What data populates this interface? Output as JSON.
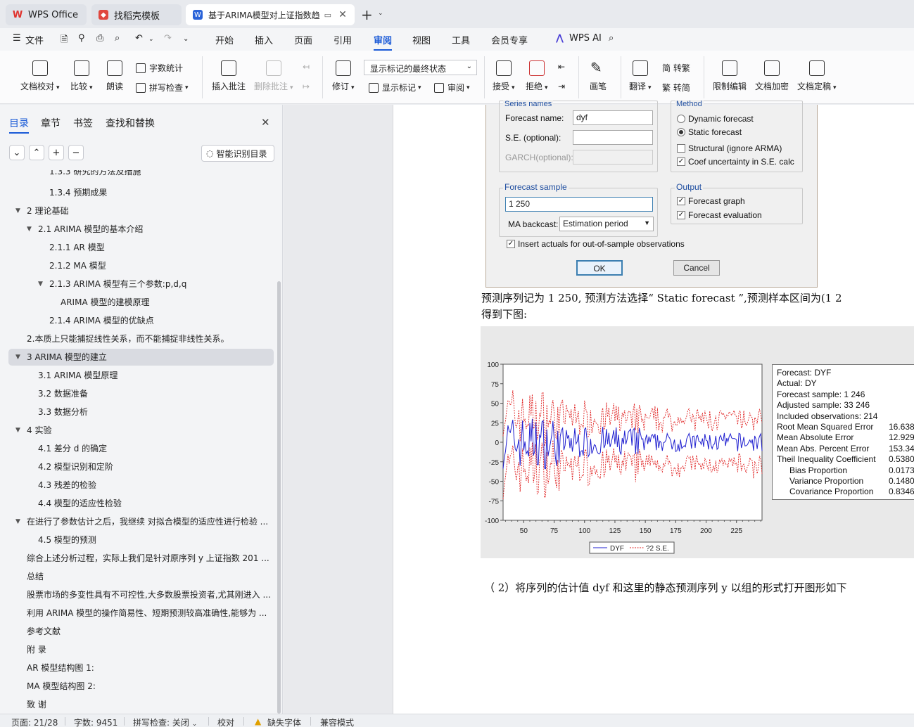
{
  "tabs": [
    {
      "label": "WPS Office"
    },
    {
      "label": "找稻壳模板"
    },
    {
      "label": "基于ARIMA模型对上证指数趋"
    }
  ],
  "menu": {
    "file": "文件",
    "items": [
      "开始",
      "插入",
      "页面",
      "引用",
      "审阅",
      "视图",
      "工具",
      "会员专享"
    ],
    "wps_ai": "WPS AI"
  },
  "ribbon": {
    "doc_check": "文档校对",
    "compare": "比较",
    "read_aloud": "朗读",
    "word_count": "字数统计",
    "spell_check": "拼写检查",
    "insert_comment": "插入批注",
    "delete_comment": "删除批注",
    "revise": "修订",
    "markup_state": "显示标记的最终状态",
    "show_markup": "显示标记",
    "review": "审阅",
    "accept": "接受",
    "reject": "拒绝",
    "pen": "画笔",
    "translate": "翻译",
    "to_traditional": "简 转繁",
    "to_simplified": "繁 转简",
    "restrict_edit": "限制编辑",
    "doc_encrypt": "文档加密",
    "doc_finalize": "文档定稿"
  },
  "panel": {
    "tabs": [
      "目录",
      "章节",
      "书签",
      "查找和替换"
    ],
    "smart_toc": "智能识别目录",
    "toc": [
      {
        "text": "1.3.3 研究的方法及措施",
        "level": 3
      },
      {
        "text": "1.3.4 预期成果",
        "level": 3
      },
      {
        "text": "2  理论基础",
        "level": 1
      },
      {
        "text": "2.1 ARIMA 模型的基本介绍",
        "level": 2
      },
      {
        "text": "2.1.1    AR 模型",
        "level": 3
      },
      {
        "text": "2.1.2    MA 模型",
        "level": 3
      },
      {
        "text": "2.1.3 ARIMA 模型有三个参数:p,d,q",
        "level": 3
      },
      {
        "text": "ARIMA 模型的建模原理",
        "level": 4
      },
      {
        "text": "2.1.4 ARIMA 模型的优缺点",
        "level": 3
      },
      {
        "text": "2.本质上只能捕捉线性关系，而不能捕捉非线性关系。",
        "level": 1
      },
      {
        "text": "3  ARIMA 模型的建立",
        "level": 1
      },
      {
        "text": "3.1 ARIMA 模型原理",
        "level": 2
      },
      {
        "text": "3.2  数据准备",
        "level": 2
      },
      {
        "text": "3.3  数据分析",
        "level": 2
      },
      {
        "text": "4  实验",
        "level": 1
      },
      {
        "text": "4.1  差分 d 的确定",
        "level": 2
      },
      {
        "text": "4.2 模型识别和定阶",
        "level": 2
      },
      {
        "text": "4.3  残差的检验",
        "level": 2
      },
      {
        "text": "4.4 模型的适应性检验",
        "level": 2
      },
      {
        "text": "在进行了参数估计之后，我继续 对拟合模型的适应性进行检验 ...",
        "level": 1
      },
      {
        "text": "4.5 模型的预测",
        "level": 2
      },
      {
        "text": "综合上述分析过程，实际上我们是针对原序列 y 上证指数 201 ...",
        "level": 1
      },
      {
        "text": "总结",
        "level": 1
      },
      {
        "text": "股票市场的多变性具有不可控性,大多数股票投资者,尤其刚进入 ...",
        "level": 1
      },
      {
        "text": "利用 ARIMA 模型的操作简易性、短期预测较高准确性,能够为 ...",
        "level": 1
      },
      {
        "text": "参考文献",
        "level": 1
      },
      {
        "text": "附  录",
        "level": 1
      },
      {
        "text": "AR 模型结构图 1:",
        "level": 1
      },
      {
        "text": "MA 模型结构图 2:",
        "level": 1
      },
      {
        "text": "致  谢",
        "level": 1
      }
    ]
  },
  "dialog": {
    "series_names": "Series names",
    "forecast_name_label": "Forecast name:",
    "forecast_name_value": "dyf",
    "se_label": "S.E. (optional):",
    "garch_label": "GARCH(optional):",
    "method": "Method",
    "dynamic": "Dynamic forecast",
    "static": "Static forecast",
    "structural": "Structural (ignore ARMA)",
    "coef_uncertainty": "Coef uncertainty in S.E. calc",
    "forecast_sample": "Forecast sample",
    "sample_value": "1 250",
    "ma_backcast_label": "MA backcast:",
    "ma_backcast_value": "Estimation period",
    "output": "Output",
    "forecast_graph": "Forecast graph",
    "forecast_evaluation": "Forecast evaluation",
    "insert_actuals": "Insert actuals for out-of-sample observations",
    "ok": "OK",
    "cancel": "Cancel"
  },
  "body": {
    "line1": "预测序列记为 1 250, 预测方法选择“ Static forecast ”,预测样本区间为(1 2",
    "line2": "得到下图:",
    "line3": "（ 2）将序列的估计值 dyf 和这里的静态预测序列 y 以组的形式打开图形如下"
  },
  "chart_data": {
    "type": "line",
    "title": "",
    "xlabel": "",
    "ylabel": "",
    "ylim": [
      -100,
      100
    ],
    "yticks": [
      100,
      75,
      50,
      25,
      0,
      -25,
      -50,
      -75,
      -100
    ],
    "xticks": [
      50,
      75,
      100,
      125,
      150,
      175,
      200,
      225
    ],
    "xlim": [
      33,
      246
    ],
    "series": [
      {
        "name": "DYF",
        "color": "#2020d0",
        "style": "solid"
      },
      {
        "name": "?2 S.E.",
        "color": "#e02020",
        "style": "dashed"
      }
    ],
    "note_series_values": "DYF oscillates around 0 with amplitude up to about ±40 early, ±15 later; bands are DYF ± 2 S.E."
  },
  "stats": {
    "labels": [
      "Forecast: DYF",
      "Actual: DY",
      "Forecast sample: 1 246",
      "Adjusted sample: 33 246",
      "Included observations: 214",
      "Root Mean Squared Error",
      "Mean Absolute Error",
      "Mean Abs. Percent Error",
      "Theil Inequality Coefficient",
      "Bias Proportion",
      "Variance Proportion",
      "Covariance Proportion"
    ],
    "values": [
      "",
      "",
      "",
      "",
      "",
      "16.638",
      "12.929",
      "153.34",
      "0.5380",
      "0.0173",
      "0.1480",
      "0.8346"
    ]
  },
  "status": {
    "page": "页面: 21/28",
    "words": "字数: 9451",
    "spell": "拼写检查: 关闭",
    "proof": "校对",
    "missing_font": "缺失字体",
    "compat": "兼容模式"
  }
}
